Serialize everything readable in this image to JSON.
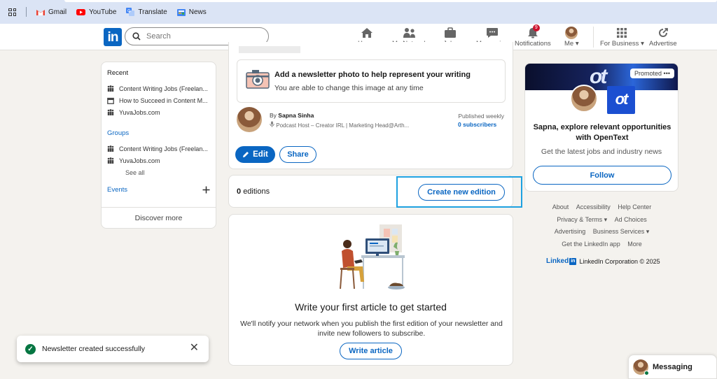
{
  "bookmarks": [
    {
      "label": "Gmail",
      "icon": "gmail-icon"
    },
    {
      "label": "YouTube",
      "icon": "youtube-icon"
    },
    {
      "label": "Translate",
      "icon": "translate-icon"
    },
    {
      "label": "News",
      "icon": "news-icon"
    }
  ],
  "nav": {
    "search_placeholder": "Search",
    "home": "Home",
    "network": "My Network",
    "jobs": "Jobs",
    "messaging": "Messaging",
    "notifications": "Notifications",
    "notifications_badge": "9",
    "me": "Me",
    "business": "For Business",
    "advertise": "Advertise"
  },
  "sidebar": {
    "recent_title": "Recent",
    "recent": [
      "Content Writing Jobs (Freelan...",
      "How to Succeed in Content M...",
      "YuvaJobs.com"
    ],
    "groups_title": "Groups",
    "groups": [
      "Content Writing Jobs (Freelan...",
      "YuvaJobs.com"
    ],
    "see_all": "See all",
    "events_title": "Events",
    "discover": "Discover more"
  },
  "newsletter": {
    "photo_title": "Add a newsletter photo to help represent your writing",
    "photo_sub": "You are able to change this image at any time",
    "by": "By",
    "author": "Sapna Sinha",
    "author_headline": "Podcast Host – Creator IRL | Marketing Head@Arth...",
    "frequency": "Published weekly",
    "subscribers": "0 subscribers",
    "edit": "Edit",
    "share": "Share"
  },
  "editions": {
    "count": "0",
    "label": "editions",
    "create": "Create new edition"
  },
  "article": {
    "title": "Write your first article to get started",
    "desc": "We'll notify your network when you publish the first edition of your newsletter and invite new followers to subscribe.",
    "cta": "Write article"
  },
  "ad": {
    "promoted": "Promoted",
    "title": "Sapna, explore relevant opportunities with OpenText",
    "sub": "Get the latest jobs and industry news",
    "follow": "Follow",
    "logo_text": "ot"
  },
  "footer": {
    "links": [
      "About",
      "Accessibility",
      "Help Center",
      "Privacy & Terms ▾",
      "Ad Choices",
      "Advertising",
      "Business Services ▾",
      "Get the LinkedIn app",
      "More"
    ],
    "brand": "Linked",
    "brand_in": "in",
    "copyright": "LinkedIn Corporation © 2025"
  },
  "toast": {
    "message": "Newsletter created successfully"
  },
  "messaging": {
    "label": "Messaging"
  },
  "colors": {
    "brand": "#0a66c2",
    "highlight": "#1ea1e0",
    "success": "#057642",
    "badge": "#cb112d"
  }
}
